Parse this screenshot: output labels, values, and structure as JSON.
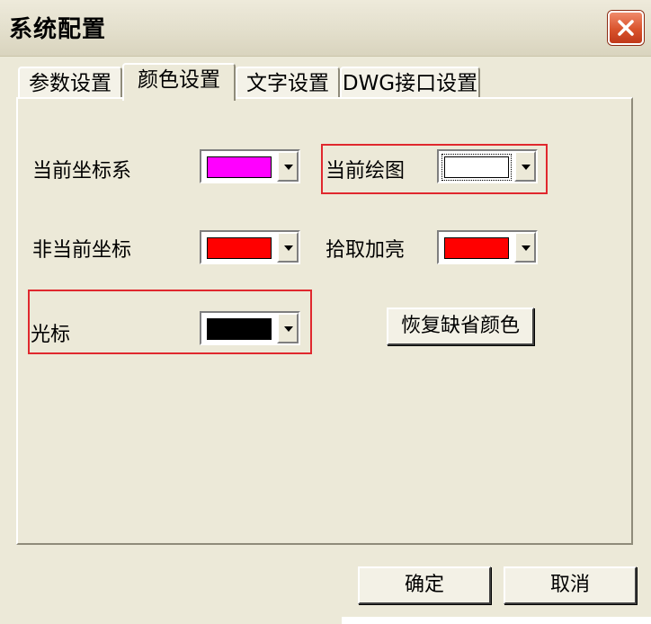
{
  "window": {
    "title": "系统配置"
  },
  "tabs": [
    "参数设置",
    "颜色设置",
    "文字设置",
    "DWG接口设置"
  ],
  "active_tab": 1,
  "colors": {
    "current_coord": {
      "label": "当前坐标系",
      "swatch": "#FF00FF"
    },
    "current_draw": {
      "label": "当前绘图",
      "swatch": "#FFFFFF"
    },
    "non_current_coord": {
      "label": "非当前坐标",
      "swatch": "#FF0000"
    },
    "pick_highlight": {
      "label": "拾取加亮",
      "swatch": "#FF0000"
    },
    "cursor": {
      "label": "光标",
      "swatch": "#000000"
    }
  },
  "buttons": {
    "restore": "恢复缺省颜色",
    "ok": "确定",
    "cancel": "取消"
  }
}
